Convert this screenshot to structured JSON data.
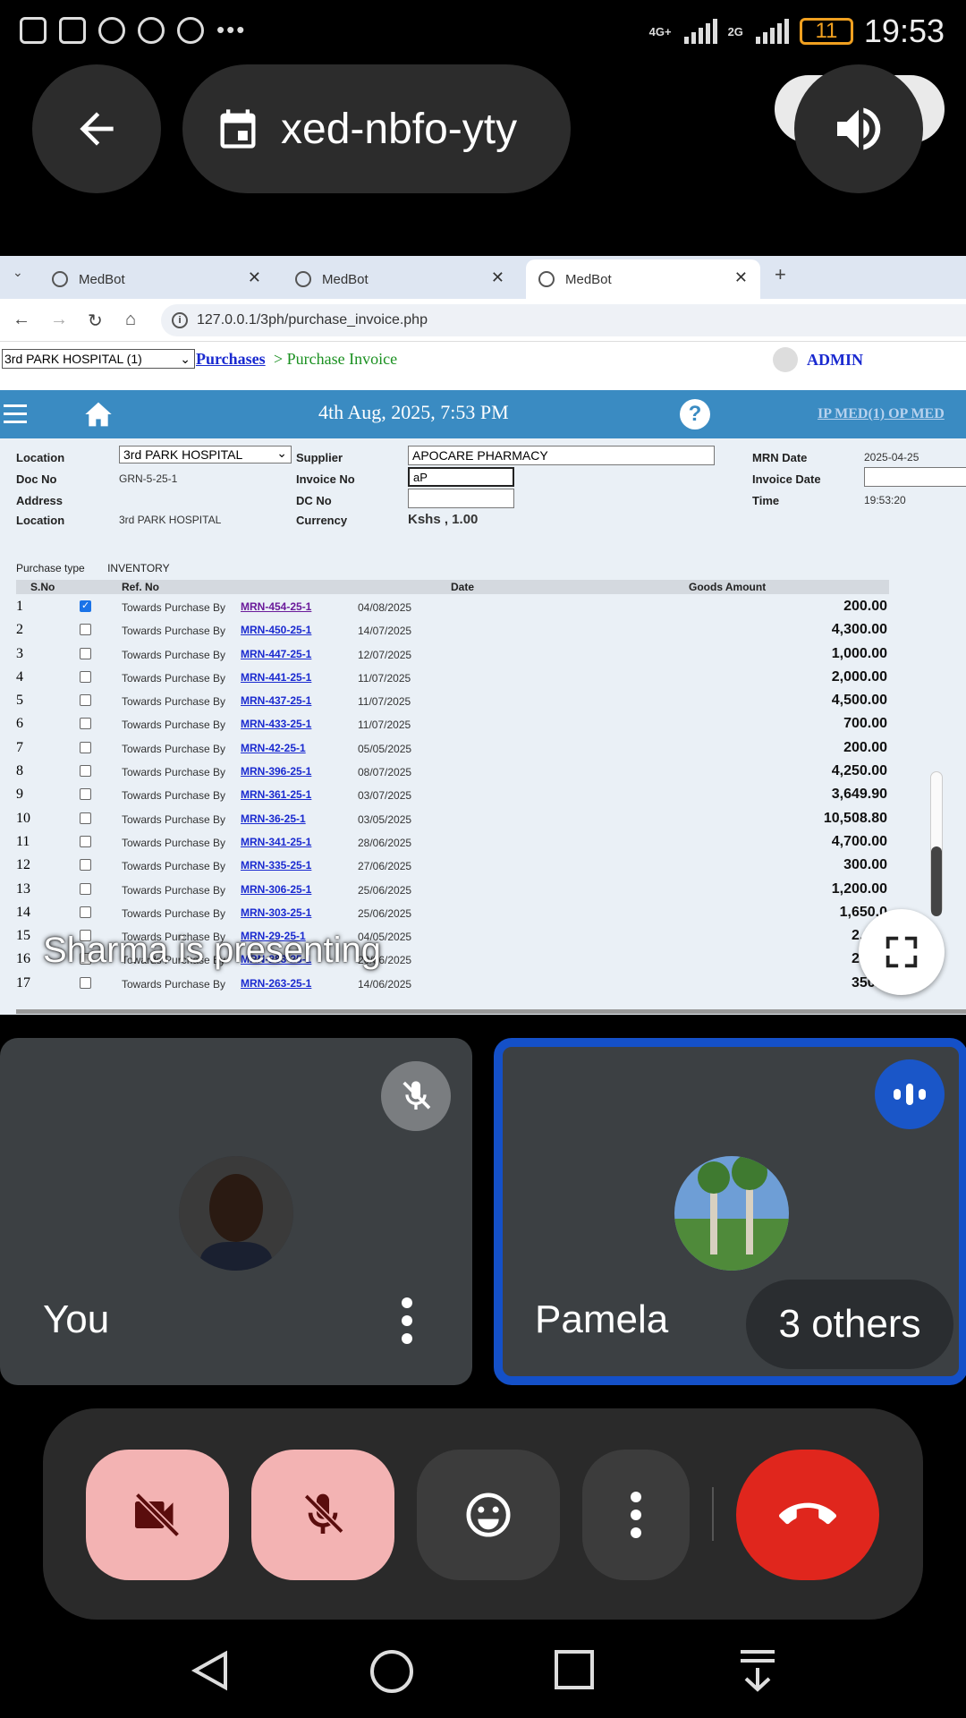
{
  "status_bar": {
    "time": "19:53",
    "battery": "11",
    "network_1": "4G+",
    "network_2": "2G"
  },
  "meet": {
    "meeting_code": "xed-nbfo-yty",
    "presenting_label": "Sharma is presenting",
    "participants": [
      {
        "name": "You",
        "muted": true
      },
      {
        "name": "Pamela",
        "speaking": true
      }
    ],
    "others_label": "3 others"
  },
  "browser": {
    "tabs": [
      {
        "title": "MedBot",
        "active": false
      },
      {
        "title": "MedBot",
        "active": false
      },
      {
        "title": "MedBot",
        "active": true
      }
    ],
    "url": "127.0.0.1/3ph/purchase_invoice.php"
  },
  "app": {
    "hospital_select": "3rd PARK HOSPITAL (1)",
    "breadcrumb_link": "Purchases",
    "breadcrumb_current": "> Purchase Invoice",
    "user": "ADMIN",
    "datetime": "4th Aug, 2025, 7:53 PM",
    "nav_links": "IP MED(1)   OP MED",
    "form": {
      "location_label": "Location",
      "location_value": "3rd PARK HOSPITAL",
      "docno_label": "Doc No",
      "docno_value": "GRN-5-25-1",
      "address_label": "Address",
      "location2_label": "Location",
      "location2_value": "3rd PARK HOSPITAL",
      "supplier_label": "Supplier",
      "supplier_value": "APOCARE PHARMACY",
      "invoiceno_label": "Invoice No",
      "invoiceno_value": "aP",
      "dcno_label": "DC No",
      "dcno_value": "",
      "currency_label": "Currency",
      "currency_value": "Kshs , 1.00",
      "mrndate_label": "MRN Date",
      "mrndate_value": "2025-04-25",
      "invoicedate_label": "Invoice Date",
      "invoicedate_value": "",
      "time_label": "Time",
      "time_value": "19:53:20"
    },
    "purchase_type_label": "Purchase type",
    "purchase_type_value": "INVENTORY",
    "table": {
      "headers": {
        "sno": "S.No",
        "ref": "Ref. No",
        "date": "Date",
        "amount": "Goods Amount"
      },
      "rows": [
        {
          "sno": "1",
          "checked": true,
          "desc": "Towards Purchase By",
          "ref": "MRN-454-25-1",
          "date": "04/08/2025",
          "amount": "200.00"
        },
        {
          "sno": "2",
          "checked": false,
          "desc": "Towards Purchase By",
          "ref": "MRN-450-25-1",
          "date": "14/07/2025",
          "amount": "4,300.00"
        },
        {
          "sno": "3",
          "checked": false,
          "desc": "Towards Purchase By",
          "ref": "MRN-447-25-1",
          "date": "12/07/2025",
          "amount": "1,000.00"
        },
        {
          "sno": "4",
          "checked": false,
          "desc": "Towards Purchase By",
          "ref": "MRN-441-25-1",
          "date": "11/07/2025",
          "amount": "2,000.00"
        },
        {
          "sno": "5",
          "checked": false,
          "desc": "Towards Purchase By",
          "ref": "MRN-437-25-1",
          "date": "11/07/2025",
          "amount": "4,500.00"
        },
        {
          "sno": "6",
          "checked": false,
          "desc": "Towards Purchase By",
          "ref": "MRN-433-25-1",
          "date": "11/07/2025",
          "amount": "700.00"
        },
        {
          "sno": "7",
          "checked": false,
          "desc": "Towards Purchase By",
          "ref": "MRN-42-25-1",
          "date": "05/05/2025",
          "amount": "200.00"
        },
        {
          "sno": "8",
          "checked": false,
          "desc": "Towards Purchase By",
          "ref": "MRN-396-25-1",
          "date": "08/07/2025",
          "amount": "4,250.00"
        },
        {
          "sno": "9",
          "checked": false,
          "desc": "Towards Purchase By",
          "ref": "MRN-361-25-1",
          "date": "03/07/2025",
          "amount": "3,649.90"
        },
        {
          "sno": "10",
          "checked": false,
          "desc": "Towards Purchase By",
          "ref": "MRN-36-25-1",
          "date": "03/05/2025",
          "amount": "10,508.80"
        },
        {
          "sno": "11",
          "checked": false,
          "desc": "Towards Purchase By",
          "ref": "MRN-341-25-1",
          "date": "28/06/2025",
          "amount": "4,700.00"
        },
        {
          "sno": "12",
          "checked": false,
          "desc": "Towards Purchase By",
          "ref": "MRN-335-25-1",
          "date": "27/06/2025",
          "amount": "300.00"
        },
        {
          "sno": "13",
          "checked": false,
          "desc": "Towards Purchase By",
          "ref": "MRN-306-25-1",
          "date": "25/06/2025",
          "amount": "1,200.00"
        },
        {
          "sno": "14",
          "checked": false,
          "desc": "Towards Purchase By",
          "ref": "MRN-303-25-1",
          "date": "25/06/2025",
          "amount": "1,650.0"
        },
        {
          "sno": "15",
          "checked": false,
          "desc": "Towards Purchase By",
          "ref": "MRN-29-25-1",
          "date": "04/05/2025",
          "amount": "2,800"
        },
        {
          "sno": "16",
          "checked": false,
          "desc": "Towards Purchase By",
          "ref": "MRN-283-25-1",
          "date": "20/06/2025",
          "amount": "2,399"
        },
        {
          "sno": "17",
          "checked": false,
          "desc": "Towards Purchase By",
          "ref": "MRN-263-25-1",
          "date": "14/06/2025",
          "amount": "350.0"
        }
      ]
    }
  },
  "colors": {
    "meet_red": "#e0261d",
    "muted_pink": "#f3b3b3",
    "app_blue": "#3a8bc2",
    "link_blue": "#1a2ad0"
  }
}
